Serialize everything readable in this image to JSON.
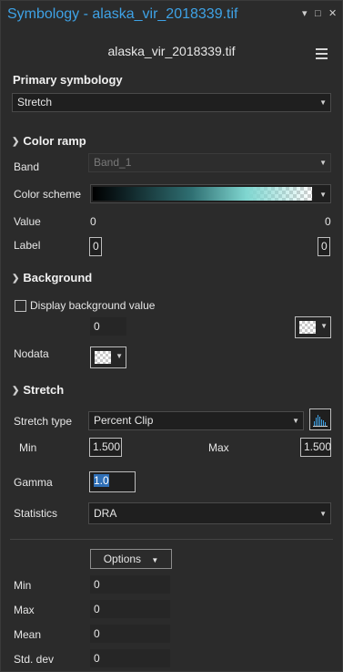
{
  "window": {
    "title": "Symbology - alaska_vir_2018339.tif"
  },
  "layer": {
    "name": "alaska_vir_2018339.tif"
  },
  "primary": {
    "heading": "Primary symbology",
    "value": "Stretch"
  },
  "color_ramp": {
    "heading": "Color ramp",
    "band_label": "Band",
    "band_value": "Band_1",
    "scheme_label": "Color scheme",
    "value_label": "Value",
    "value_min": "0",
    "value_max": "0",
    "label_label": "Label",
    "label_min": "0",
    "label_max": "0"
  },
  "background": {
    "heading": "Background",
    "display_label": "Display background value",
    "display_checked": false,
    "value": "0",
    "nodata_label": "Nodata"
  },
  "stretch": {
    "heading": "Stretch",
    "type_label": "Stretch type",
    "type_value": "Percent Clip",
    "min_label": "Min",
    "min_value": "1.500",
    "max_label": "Max",
    "max_value": "1.500",
    "gamma_label": "Gamma",
    "gamma_value": "1.0",
    "statistics_label": "Statistics",
    "statistics_value": "DRA"
  },
  "stats": {
    "options_label": "Options",
    "rows": [
      {
        "label": "Min",
        "value": "0"
      },
      {
        "label": "Max",
        "value": "0"
      },
      {
        "label": "Mean",
        "value": "0"
      },
      {
        "label": "Std. dev",
        "value": "0"
      }
    ]
  },
  "icons": {
    "menu": "hamburger-icon",
    "pin": "pin-icon",
    "restore": "restore-icon",
    "close": "close-icon",
    "histogram": "histogram-icon"
  },
  "colors": {
    "title": "#3ea2e6",
    "ramp_start": "#000000",
    "ramp_end": "#7fd6d0"
  }
}
